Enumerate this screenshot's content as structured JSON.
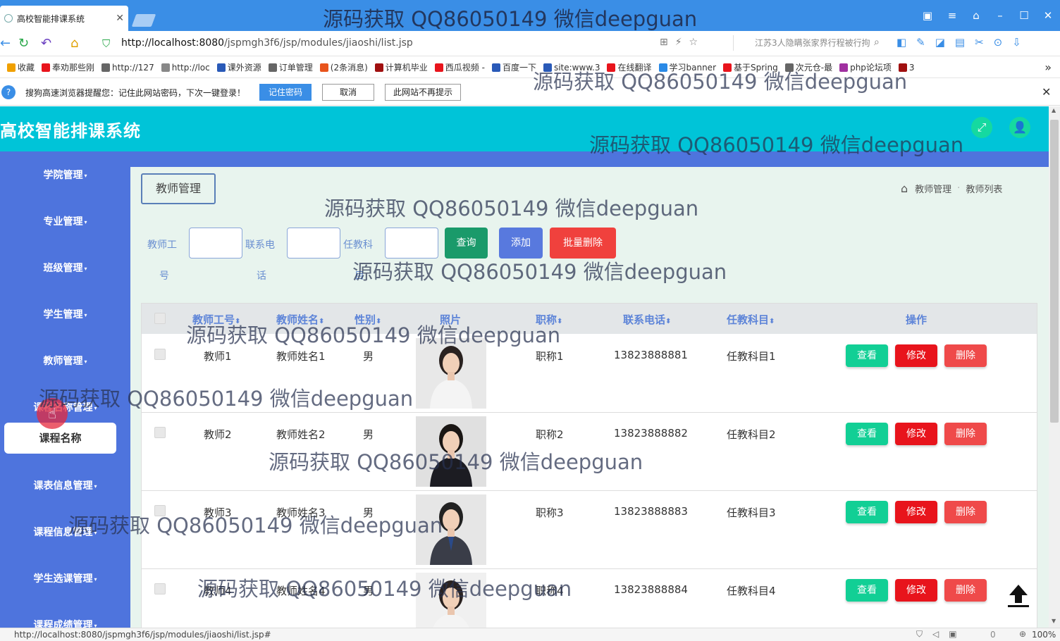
{
  "browser": {
    "tab_title": "高校智能排课系统",
    "window_title_watermark": "源码获取 QQ86050149 微信deepguan",
    "url_host": "http://localhost:8080",
    "url_path": "/jspmgh3f6/jsp/modules/jiaoshi/list.jsp",
    "search_text": "江苏3人隐瞒张家界行程被行拘",
    "bookmarks": [
      "收藏",
      "奉劝那些刚",
      "http://127",
      "http://loc",
      "课外资源",
      "订单管理",
      "(2条消息)",
      "计算机毕业",
      "西瓜视频 -",
      "百度一下",
      "site:www.3",
      "在线翻译",
      "学习banner",
      "基于Spring",
      "次元仓-最",
      "php论坛项",
      "3"
    ],
    "password_prompt": "搜狗高速浏览器提醒您：记住此网站密码，下次一键登录！",
    "remember_btn": "记住密码",
    "cancel_btn": "取消",
    "never_btn": "此网站不再提示",
    "status_url": "http://localhost:8080/jspmgh3f6/jsp/modules/jiaoshi/list.jsp#",
    "zoom": "100%",
    "status_count": "0"
  },
  "app": {
    "title": "高校智能排课系统"
  },
  "sidebar": {
    "items": [
      "学院管理",
      "专业管理",
      "班级管理",
      "学生管理",
      "教师管理",
      "课程名称管理",
      "课表信息管理",
      "课程信息管理",
      "学生选课管理",
      "课程成绩管理"
    ],
    "active_sub": "课程名称"
  },
  "page": {
    "title": "教师管理",
    "breadcrumb": [
      "教师管理",
      "教师列表"
    ]
  },
  "filters": {
    "teacher_no_label_1": "教师工",
    "teacher_no_label_2": "号",
    "phone_label_1": "联系电",
    "phone_label_2": "话",
    "subject_label_1": "任教科",
    "subject_label_2": "目",
    "query_btn": "查询",
    "add_btn": "添加",
    "batch_delete_btn": "批量删除"
  },
  "table": {
    "headers": [
      "教师工号",
      "教师姓名",
      "性别",
      "照片",
      "职称",
      "联系电话",
      "任教科目",
      "操作"
    ],
    "rows": [
      {
        "no": "教师1",
        "name": "教师姓名1",
        "gender": "男",
        "title": "职称1",
        "phone": "13823888881",
        "subject": "任教科目1"
      },
      {
        "no": "教师2",
        "name": "教师姓名2",
        "gender": "男",
        "title": "职称2",
        "phone": "13823888882",
        "subject": "任教科目2"
      },
      {
        "no": "教师3",
        "name": "教师姓名3",
        "gender": "男",
        "title": "职称3",
        "phone": "13823888883",
        "subject": "任教科目3"
      },
      {
        "no": "教师4",
        "name": "教师姓名4",
        "gender": "男",
        "title": "职称4",
        "phone": "13823888884",
        "subject": "任教科目4"
      }
    ],
    "view_btn": "查看",
    "edit_btn": "修改",
    "delete_btn": "删除"
  },
  "watermark": "源码获取 QQ86050149 微信deepguan",
  "colors": {
    "header": "#00c4d8",
    "sidebar": "#4e74dd",
    "query": "#1a9a6a",
    "add": "#5879de",
    "danger": "#f0413d",
    "view": "#12cf95",
    "edit": "#e8141c",
    "delete": "#ef4a4a"
  }
}
